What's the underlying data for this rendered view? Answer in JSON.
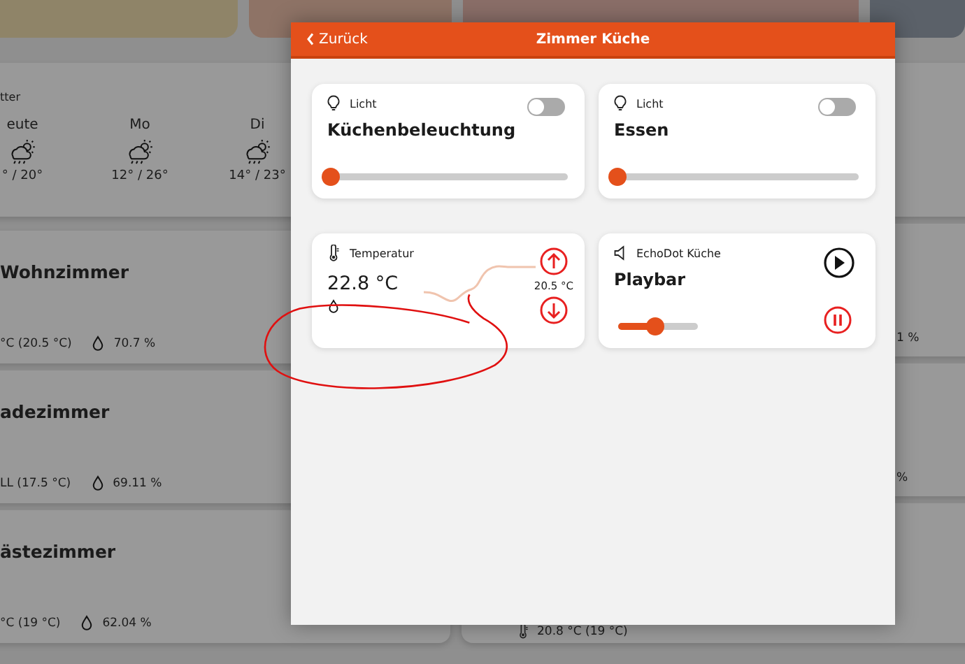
{
  "background": {
    "weather": {
      "title": "tter",
      "days": [
        {
          "label": "eute",
          "temps": "° / 20°"
        },
        {
          "label": "Mo",
          "temps": "12° / 26°"
        },
        {
          "label": "Di",
          "temps": "14° / 23°"
        }
      ]
    },
    "rooms": [
      {
        "name": "Wohnzimmer",
        "reading": "°C (20.5 °C)",
        "humidity": "70.7 %"
      },
      {
        "name": "adezimmer",
        "reading": "LL (17.5 °C)",
        "humidity": "69.11 %"
      },
      {
        "name": "ästezimmer",
        "reading": "°C (19 °C)",
        "humidity": "62.04 %"
      }
    ],
    "right_rooms": [
      {
        "humidity": "1 %"
      },
      {
        "humidity": "%"
      },
      {
        "reading": "20.8 °C (19 °C)"
      }
    ]
  },
  "dialog": {
    "back_label": "Zurück",
    "title": "Zimmer Küche",
    "cards": [
      {
        "kind": "light",
        "type_label": "Licht",
        "name": "Küchenbeleuchtung",
        "on": false,
        "level": 0.03
      },
      {
        "kind": "light",
        "type_label": "Licht",
        "name": "Essen",
        "on": false,
        "level": 0.03
      },
      {
        "kind": "thermostat",
        "type_label": "Temperatur",
        "value": "22.8 °C",
        "setpoint": "20.5 °C"
      },
      {
        "kind": "media",
        "type_label": "EchoDot Küche",
        "name": "Playbar",
        "level": 0.45
      }
    ]
  }
}
